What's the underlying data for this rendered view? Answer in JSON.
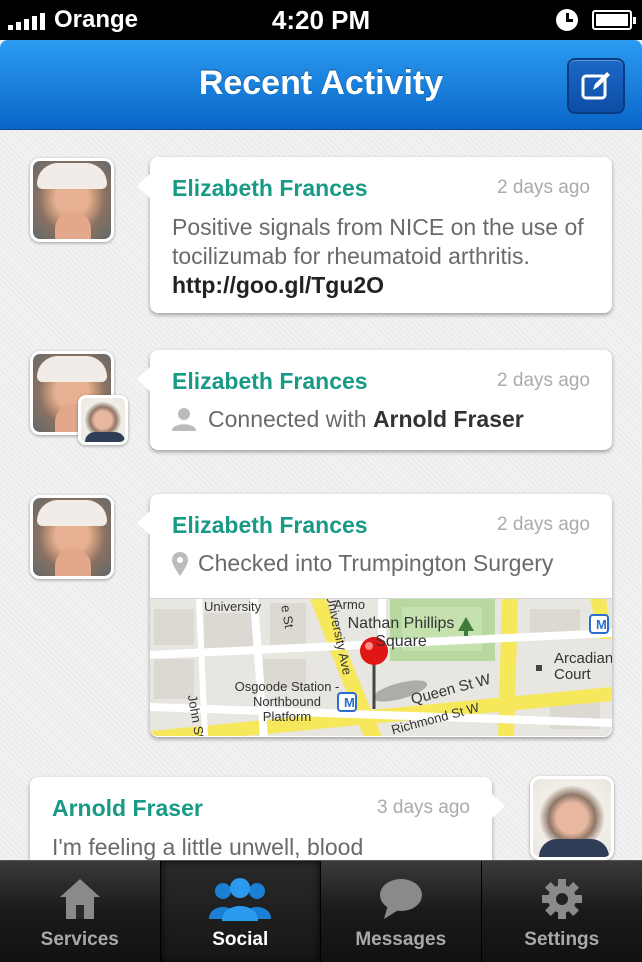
{
  "status_bar": {
    "carrier": "Orange",
    "time": "4:20 PM"
  },
  "nav": {
    "title": "Recent Activity",
    "compose_icon": "compose-icon"
  },
  "feed": [
    {
      "author": "Elizabeth Frances",
      "time": "2 days ago",
      "text": "Positive signals from NICE on the use of tocilizumab for rheumatoid arthritis. ",
      "link": "http://goo.gl/Tgu2O"
    },
    {
      "author": "Elizabeth Frances",
      "time": "2 days ago",
      "prefix": "Connected with ",
      "person": "Arnold Fraser"
    },
    {
      "author": "Elizabeth Frances",
      "time": "2 days ago",
      "text": "Checked into Trumpington Surgery",
      "map": {
        "labels": [
          "University",
          "Nathan Phillips Square",
          "Arcadian Court",
          "Osgoode Station - Northbound Platform",
          "Queen St W",
          "Richmond St W",
          "John St",
          "University Ave",
          "Armo",
          "e St"
        ],
        "metro_marker": "M"
      }
    },
    {
      "author": "Arnold Fraser",
      "time": "3 days ago",
      "text": "I'm feeling a little unwell, blood"
    }
  ],
  "tabs": [
    {
      "label": "Services",
      "icon": "house-icon",
      "active": false
    },
    {
      "label": "Social",
      "icon": "people-icon",
      "active": true
    },
    {
      "label": "Messages",
      "icon": "speech-bubble-icon",
      "active": false
    },
    {
      "label": "Settings",
      "icon": "gear-icon",
      "active": false
    }
  ],
  "colors": {
    "accent": "#199a86",
    "nav_blue": "#0a66c8",
    "map_road": "#f6e85a",
    "map_park": "#b7d9a0"
  }
}
